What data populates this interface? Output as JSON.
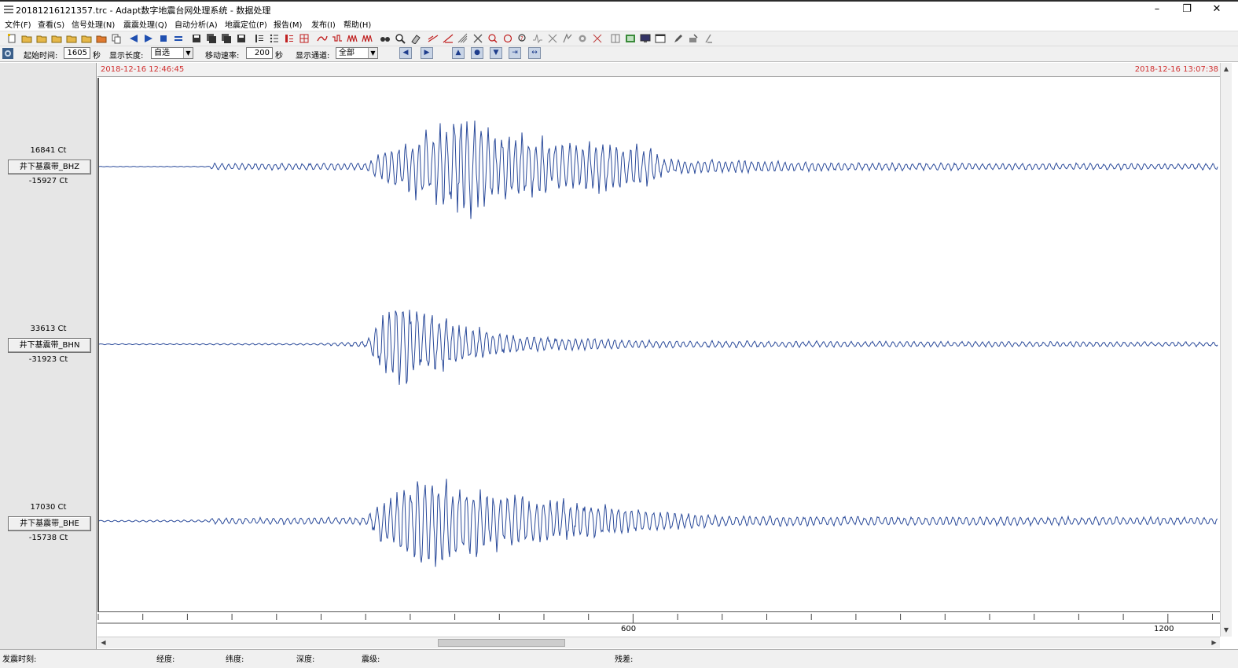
{
  "window": {
    "title": "20181216121357.trc - Adapt数字地震台网处理系统 - 数据处理",
    "controls": [
      "–",
      "❐",
      "✕"
    ]
  },
  "menu": [
    "文件(F)",
    "查看(S)",
    "信号处理(N)",
    "震震处理(Q)",
    "自动分析(A)",
    "地震定位(P)",
    "报告(M)",
    "发布(I)",
    "帮助(H)"
  ],
  "controls": {
    "start_label": "起始时间:",
    "start_value": "1605",
    "start_unit": "秒",
    "length_label": "显示长度:",
    "length_value": "自选",
    "speed_label": "移动速率:",
    "speed_value": "200",
    "speed_unit": "秒",
    "channel_label": "显示通道:",
    "channel_value": "全部"
  },
  "time_range": {
    "start": "2018-12-16 12:46:45",
    "end": "2018-12-16 13:07:38"
  },
  "channels": [
    {
      "max": "16841 Ct",
      "name": "井下基震带_BHZ",
      "min": "-15927 Ct"
    },
    {
      "max": "33613 Ct",
      "name": "井下基震带_BHN",
      "min": "-31923 Ct"
    },
    {
      "max": "17030 Ct",
      "name": "井下基震带_BHE",
      "min": "-15738 Ct"
    }
  ],
  "axis": {
    "labels": [
      "600",
      "1200"
    ]
  },
  "status": {
    "origin_time": "发震时刻:",
    "longitude": "经度:",
    "latitude": "纬度:",
    "depth": "深度:",
    "magnitude": "震级:",
    "residual": "残差:"
  },
  "colors": {
    "waveform": "#2a4a9a",
    "timestamp": "#d03030"
  }
}
